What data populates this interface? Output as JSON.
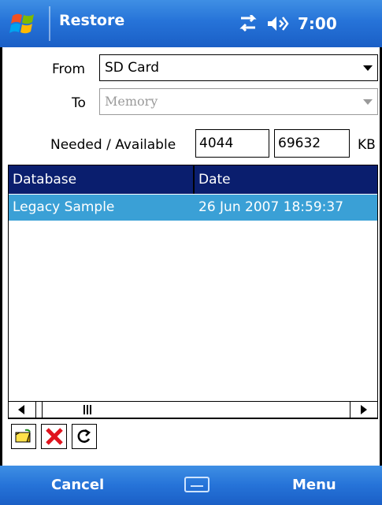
{
  "titlebar": {
    "title": "Restore",
    "time": "7:00",
    "icons": [
      "windows-start-icon",
      "connectivity-icon",
      "speaker-icon"
    ]
  },
  "form": {
    "from_label": "From",
    "from_value": "SD Card",
    "to_label": "To",
    "to_value": "Memory",
    "needed_label": "Needed / Available",
    "needed_value": "4044",
    "available_value": "69632",
    "unit": "KB"
  },
  "list": {
    "columns": [
      "Database",
      "Date"
    ],
    "rows": [
      {
        "database": "Legacy Sample",
        "date": "26 Jun 2007 18:59:37"
      }
    ],
    "selected_index": 0
  },
  "toolbar": {
    "icons": [
      "open-folder-icon",
      "delete-icon",
      "refresh-icon"
    ]
  },
  "menubar": {
    "left": "Cancel",
    "right": "Menu",
    "center_icon": "keyboard-icon"
  },
  "colors": {
    "bar_blue": "#2673d8",
    "header_navy": "#0a1e6e",
    "selection": "#3aa0d6",
    "delete_red": "#e0141e"
  }
}
